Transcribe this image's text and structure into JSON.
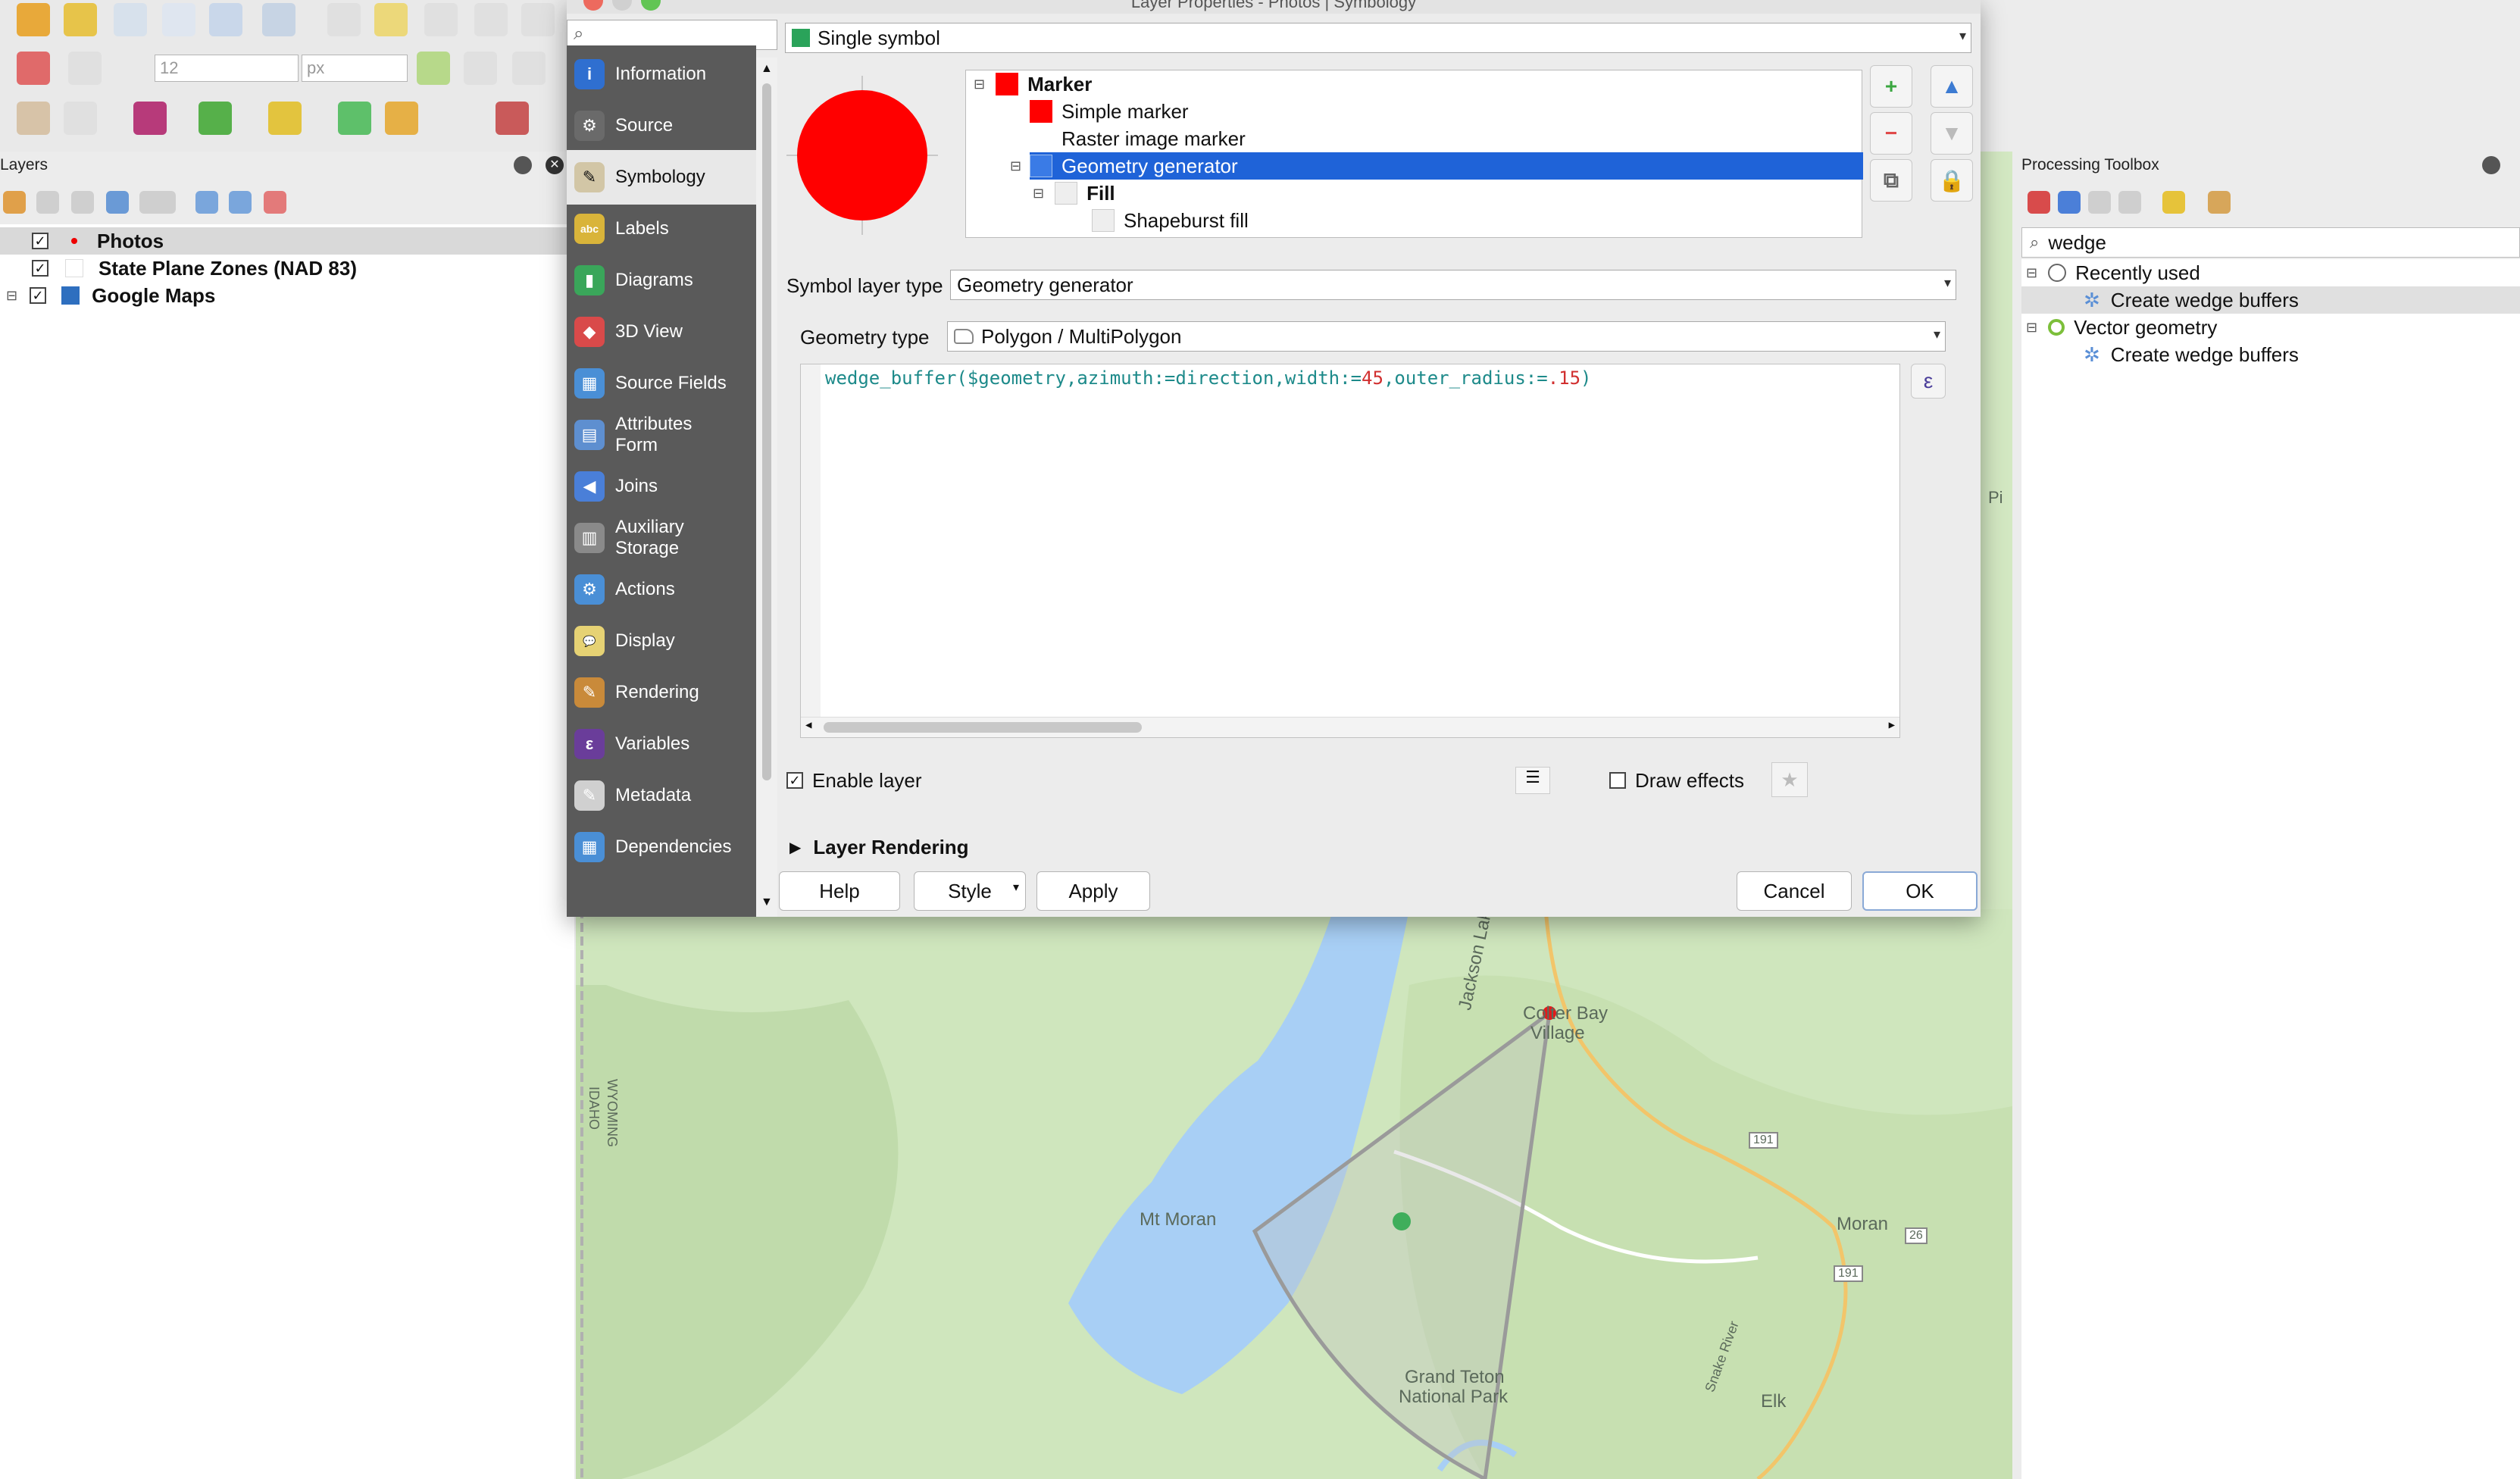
{
  "dialog": {
    "title": "Layer Properties - Photos | Symbology",
    "nav_items": [
      {
        "label": "Information",
        "icon": "information-icon"
      },
      {
        "label": "Source",
        "icon": "source-icon"
      },
      {
        "label": "Symbology",
        "icon": "symbology-icon",
        "selected": true
      },
      {
        "label": "Labels",
        "icon": "labels-icon"
      },
      {
        "label": "Diagrams",
        "icon": "diagrams-icon"
      },
      {
        "label": "3D View",
        "icon": "3d-view-icon"
      },
      {
        "label": "Source Fields",
        "icon": "source-fields-icon"
      },
      {
        "label": "Attributes\nForm",
        "icon": "attributes-form-icon"
      },
      {
        "label": "Joins",
        "icon": "joins-icon"
      },
      {
        "label": "Auxiliary\nStorage",
        "icon": "auxiliary-storage-icon"
      },
      {
        "label": "Actions",
        "icon": "actions-icon"
      },
      {
        "label": "Display",
        "icon": "display-icon"
      },
      {
        "label": "Rendering",
        "icon": "rendering-icon"
      },
      {
        "label": "Variables",
        "icon": "variables-icon"
      },
      {
        "label": "Metadata",
        "icon": "metadata-icon"
      },
      {
        "label": "Dependencies",
        "icon": "dependencies-icon"
      }
    ],
    "renderer": "Single symbol",
    "symbol_tree": [
      {
        "label": "Marker",
        "bold": true,
        "color": "#ff0000"
      },
      {
        "label": "Simple marker",
        "color": "#ff0000"
      },
      {
        "label": "Raster image marker",
        "color": ""
      },
      {
        "label": "Geometry generator",
        "color": "#1f5fd6",
        "selected": true
      },
      {
        "label": "Fill",
        "bold": true,
        "color": "#dddddd"
      },
      {
        "label": "Shapeburst fill",
        "color": "#dddddd"
      }
    ],
    "symbol_layer_type_label": "Symbol layer type",
    "symbol_layer_type": "Geometry generator",
    "geometry_type_label": "Geometry type",
    "geometry_type": "Polygon / MultiPolygon",
    "expression": {
      "func": "wedge_buffer(",
      "field1": "$geometry",
      "p1": ",azimuth:=",
      "field2": "direction",
      "p2": ",width:=",
      "num1": "45",
      "p3": ",outer_radius:=",
      "num2": ".15",
      "close": ")"
    },
    "enable_layer": "Enable layer",
    "draw_effects": "Draw effects",
    "layer_rendering": "Layer Rendering",
    "buttons": {
      "help": "Help",
      "style": "Style",
      "apply": "Apply",
      "cancel": "Cancel",
      "ok": "OK"
    },
    "epsilon": "ε"
  },
  "layers_panel": {
    "title": "Layers",
    "items": [
      {
        "label": "Photos",
        "checked": true,
        "bold": true
      },
      {
        "label": "State Plane Zones (NAD 83)",
        "checked": true
      },
      {
        "label": "Google Maps",
        "checked": true
      }
    ]
  },
  "toolbar": {
    "size_value": "12",
    "unit_value": "px"
  },
  "processing": {
    "title": "Processing Toolbox",
    "search_value": "wedge",
    "groups": [
      {
        "label": "Recently used",
        "items": [
          "Create wedge buffers"
        ]
      },
      {
        "label": "Vector geometry",
        "items": [
          "Create wedge buffers"
        ]
      }
    ]
  },
  "map": {
    "labels": {
      "lake": "Jackson Lake",
      "colter": "Colter Bay",
      "village": "Village",
      "moran_mt": "Mt Moran",
      "moran": "Moran",
      "park1": "Grand Teton",
      "park2": "National Park",
      "elk": "Elk",
      "snake": "Snake River",
      "state1": "WYOMING",
      "state2": "IDAHO",
      "r191a": "191",
      "r191b": "191",
      "r26": "26",
      "pi": "Pi"
    }
  }
}
